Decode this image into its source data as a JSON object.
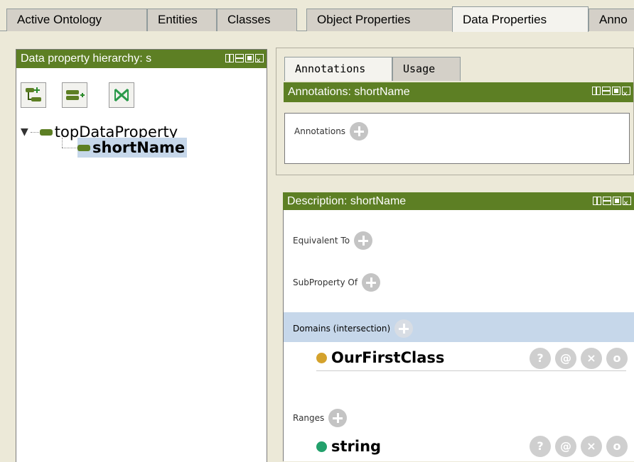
{
  "top_tabs": [
    {
      "label": "Active Ontology"
    },
    {
      "label": "Entities"
    },
    {
      "label": "Classes"
    },
    {
      "label": "Object Properties"
    },
    {
      "label": "Data Properties",
      "selected": true
    },
    {
      "label": "Anno"
    }
  ],
  "hierarchy": {
    "header": "Data property hierarchy: s",
    "tools": [
      "add-sub-property-icon",
      "add-sibling-property-icon",
      "delete-property-icon"
    ],
    "tree": [
      {
        "label": "topDataProperty",
        "expanded": true
      },
      {
        "label": "shortName",
        "selected": true
      }
    ]
  },
  "sub_tabs": [
    {
      "label": "Annotations",
      "selected": true
    },
    {
      "label": "Usage"
    }
  ],
  "annotations_view": {
    "header": "Annotations: shortName",
    "section_label": "Annotations"
  },
  "description_view": {
    "header": "Description: shortName",
    "equivalent_label": "Equivalent To",
    "subproperty_label": "SubProperty Of",
    "domains_label": "Domains (intersection)",
    "domain_item": "OurFirstClass",
    "ranges_label": "Ranges",
    "range_item": "string",
    "action_glyphs": [
      "?",
      "@",
      "×",
      "o"
    ]
  },
  "colors": {
    "view_header": "#5d7f24",
    "class_dot": "#d4a22c",
    "datatype_dot": "#22a06b",
    "selection": "#c6d7ea"
  }
}
